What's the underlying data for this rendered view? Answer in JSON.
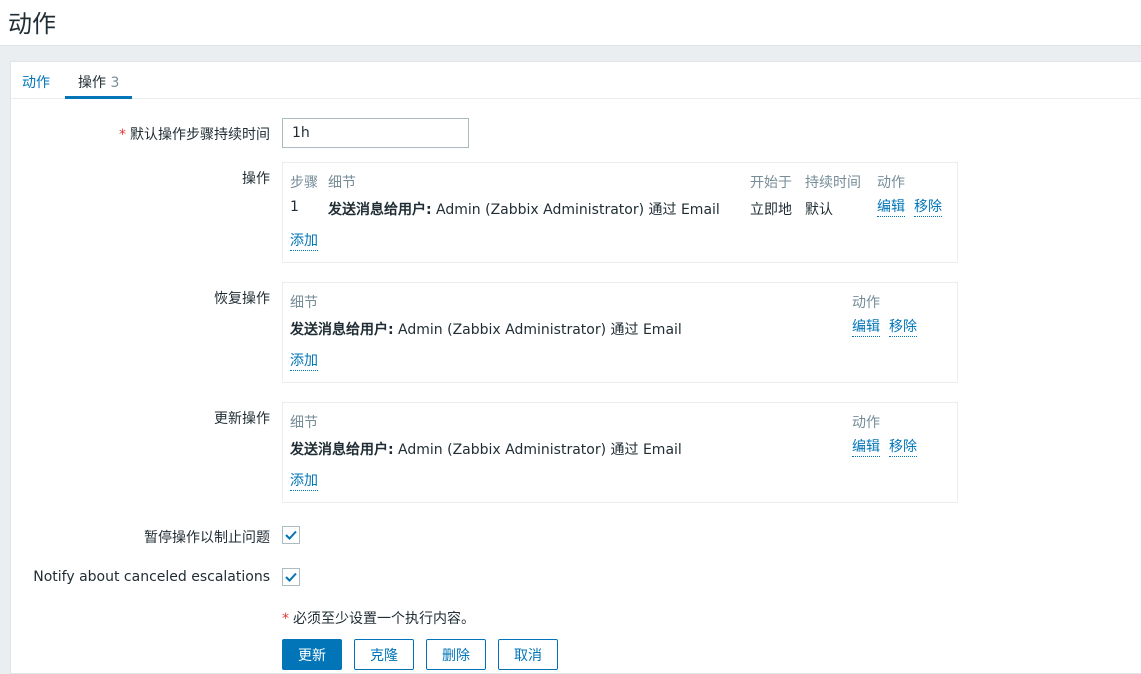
{
  "page": {
    "title": "动作"
  },
  "tabs": [
    {
      "label": "动作"
    },
    {
      "label": "操作",
      "count": "3"
    }
  ],
  "form": {
    "step_duration": {
      "required_mark": "*",
      "label": "默认操作步骤持续时间",
      "value": "1h"
    },
    "operations": {
      "label": "操作",
      "columns": [
        "步骤",
        "细节",
        "开始于",
        "持续时间",
        "动作"
      ],
      "rows": [
        {
          "step": "1",
          "detail_bold": "发送消息给用户:",
          "detail_rest": " Admin (Zabbix Administrator) 通过 Email",
          "start_in": "立即地",
          "duration": "默认",
          "edit": "编辑",
          "remove": "移除"
        }
      ],
      "add": "添加"
    },
    "recovery_operations": {
      "label": "恢复操作",
      "columns": [
        "细节",
        "动作"
      ],
      "rows": [
        {
          "detail_bold": "发送消息给用户:",
          "detail_rest": " Admin (Zabbix Administrator) 通过 Email",
          "edit": "编辑",
          "remove": "移除"
        }
      ],
      "add": "添加"
    },
    "update_operations": {
      "label": "更新操作",
      "columns": [
        "细节",
        "动作"
      ],
      "rows": [
        {
          "detail_bold": "发送消息给用户:",
          "detail_rest": " Admin (Zabbix Administrator) 通过 Email",
          "edit": "编辑",
          "remove": "移除"
        }
      ],
      "add": "添加"
    },
    "pause_operations": {
      "label": "暂停操作以制止问题",
      "checked": true
    },
    "notify_canceled": {
      "label": "Notify about canceled escalations",
      "checked": true
    },
    "note": {
      "mark": "*",
      "text": "必须至少设置一个执行内容。"
    }
  },
  "buttons": {
    "update": "更新",
    "clone": "克隆",
    "delete": "删除",
    "cancel": "取消"
  },
  "colors": {
    "accent": "#0275b8",
    "required": "#e33734",
    "muted": "#768d99"
  }
}
